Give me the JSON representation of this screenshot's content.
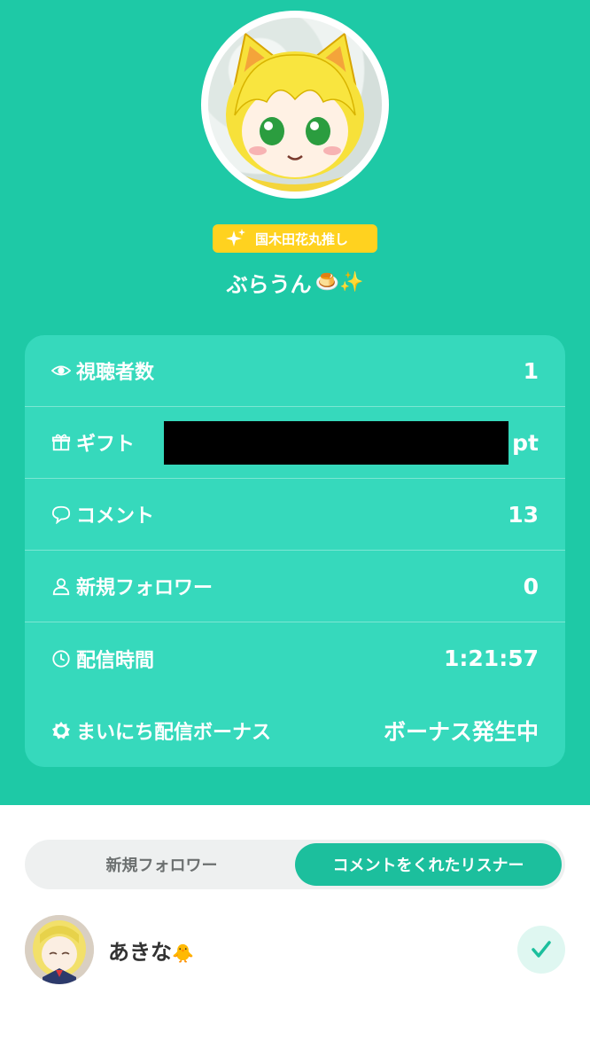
{
  "header": {
    "badge_text": "国木田花丸推し",
    "streamer_name": "ぶらうん",
    "name_emojis": "🍮✨"
  },
  "stats": {
    "viewers": {
      "label": "視聴者数",
      "value": "1",
      "icon": "eye-icon"
    },
    "gift": {
      "label": "ギフト",
      "unit": "pt",
      "icon": "gift-icon"
    },
    "comments": {
      "label": "コメント",
      "value": "13",
      "icon": "speech-bubble-icon"
    },
    "new_followers": {
      "label": "新規フォロワー",
      "value": "0",
      "icon": "person-icon"
    },
    "stream_time": {
      "label": "配信時間",
      "value": "1:21:57",
      "icon": "clock-icon"
    },
    "daily_bonus": {
      "label": "まいにち配信ボーナス",
      "value": "ボーナス発生中",
      "icon": "sun-badge-icon"
    }
  },
  "tabs": {
    "items": [
      {
        "label": "新規フォロワー",
        "active": false
      },
      {
        "label": "コメントをくれたリスナー",
        "active": true
      }
    ]
  },
  "listeners": [
    {
      "name": "あきな",
      "emoji": "🐥",
      "checked": true
    }
  ],
  "colors": {
    "brand_green": "#1ec9a6",
    "card_green": "#36d9bc",
    "badge_yellow": "#ffd21f",
    "active_tab": "#1cbf9d"
  }
}
